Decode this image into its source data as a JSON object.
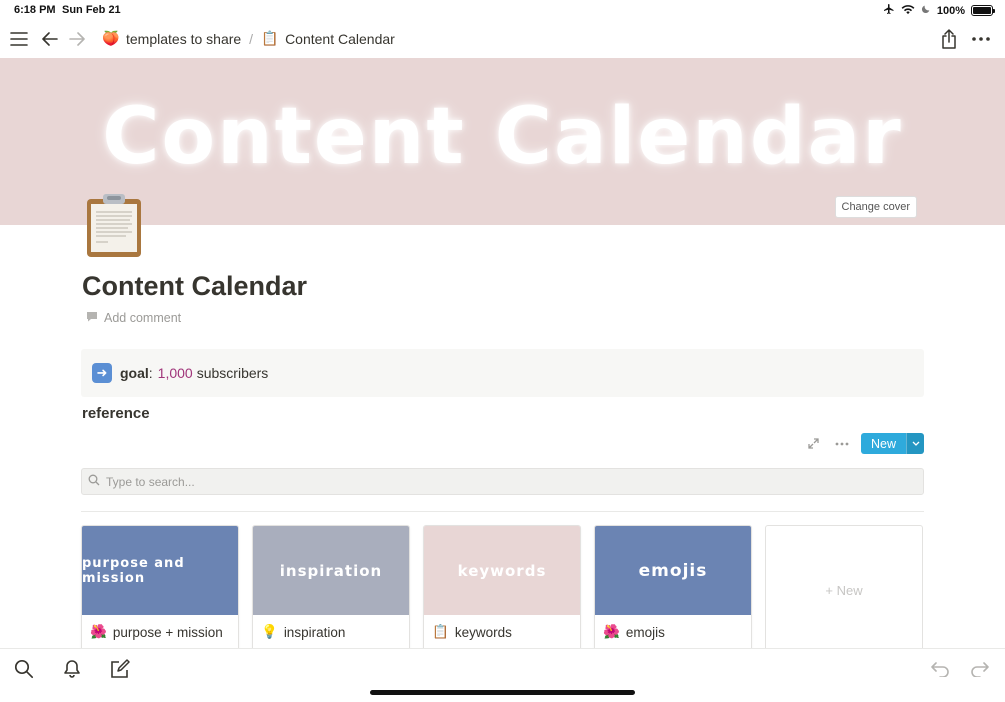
{
  "status": {
    "time": "6:18 PM",
    "date": "Sun Feb 21",
    "battery": "100%",
    "battery_level": 1.0
  },
  "nav": {
    "breadcrumbs": [
      {
        "icon": "peach-emoji",
        "glyph": "🍑",
        "label": "templates to share"
      },
      {
        "icon": "clipboard-emoji",
        "glyph": "📋",
        "label": "Content Calendar"
      }
    ],
    "separator": "/"
  },
  "cover": {
    "title": "Content Calendar",
    "change_cover_label": "Change cover",
    "color": "#e8d6d5"
  },
  "page": {
    "title": "Content Calendar",
    "add_comment": "Add comment"
  },
  "callout": {
    "icon": "➡️",
    "goal_label": "goal",
    "colon": ":",
    "goal_number": "1,000",
    "goal_suffix": "subscribers"
  },
  "section": {
    "heading": "reference"
  },
  "database": {
    "new_label": "New",
    "search_placeholder": "Type to search...",
    "cards": [
      {
        "cover_text": "purpose and mission",
        "cover_color": "#6b84b3",
        "emoji": "🌺",
        "label": "purpose + mission"
      },
      {
        "cover_text": "inspiration",
        "cover_color": "#a9aebd",
        "emoji": "💡",
        "label": "inspiration"
      },
      {
        "cover_text": "keywords",
        "cover_color": "#e8d6d5",
        "emoji": "📋",
        "label": "keywords"
      },
      {
        "cover_text": "emojis",
        "cover_color": "#6b84b3",
        "emoji": "🌺",
        "label": "emojis"
      }
    ],
    "new_card_label": "+ New"
  },
  "colors": {
    "accent": "#2eaadc",
    "text": "#37352f",
    "muted": "#9b9a97",
    "highlight_number": "#a0357a"
  }
}
